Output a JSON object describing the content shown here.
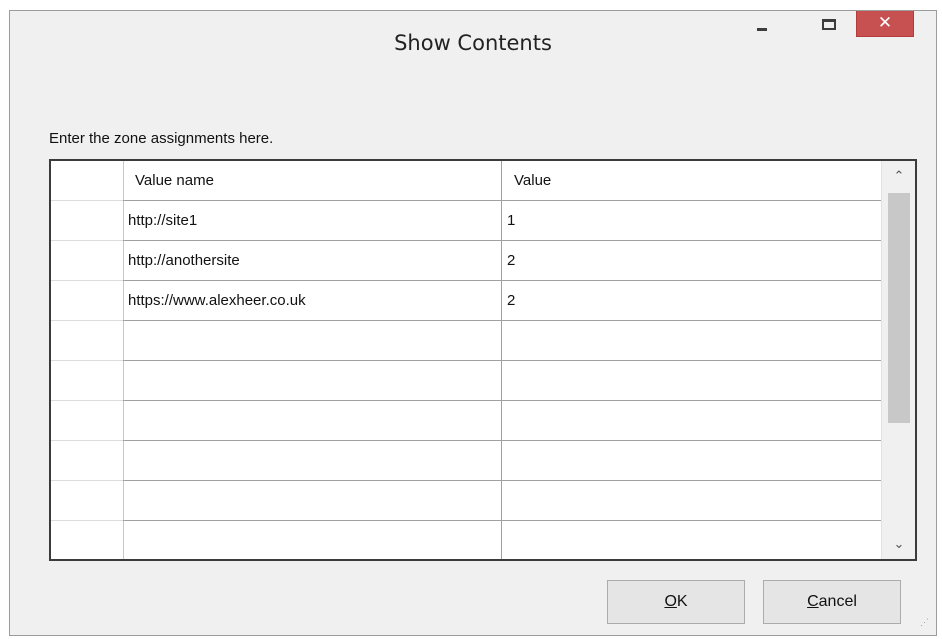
{
  "window": {
    "title": "Show Contents"
  },
  "titlebar": {
    "minimize_glyph": "–",
    "close_glyph": "✕"
  },
  "prompt": "Enter the zone assignments here.",
  "grid": {
    "columns": [
      "Value name",
      "Value"
    ],
    "rows": [
      [
        "http://site1",
        "1"
      ],
      [
        "http://anothersite",
        "2"
      ],
      [
        "https://www.alexheer.co.uk",
        "2"
      ],
      [
        "",
        ""
      ],
      [
        "",
        ""
      ],
      [
        "",
        ""
      ],
      [
        "",
        ""
      ],
      [
        "",
        ""
      ],
      [
        "",
        ""
      ]
    ]
  },
  "scrollbar": {
    "up_glyph": "⌃",
    "down_glyph": "⌄"
  },
  "buttons": {
    "ok": {
      "label": "OK",
      "mnemonic": "O",
      "rest": "K"
    },
    "cancel": {
      "label": "Cancel",
      "mnemonic": "C",
      "rest": "ancel"
    }
  },
  "icons": [
    "minimize-icon",
    "maximize-icon",
    "close-icon",
    "scroll-up-icon",
    "scroll-down-icon",
    "resize-grip-icon"
  ]
}
